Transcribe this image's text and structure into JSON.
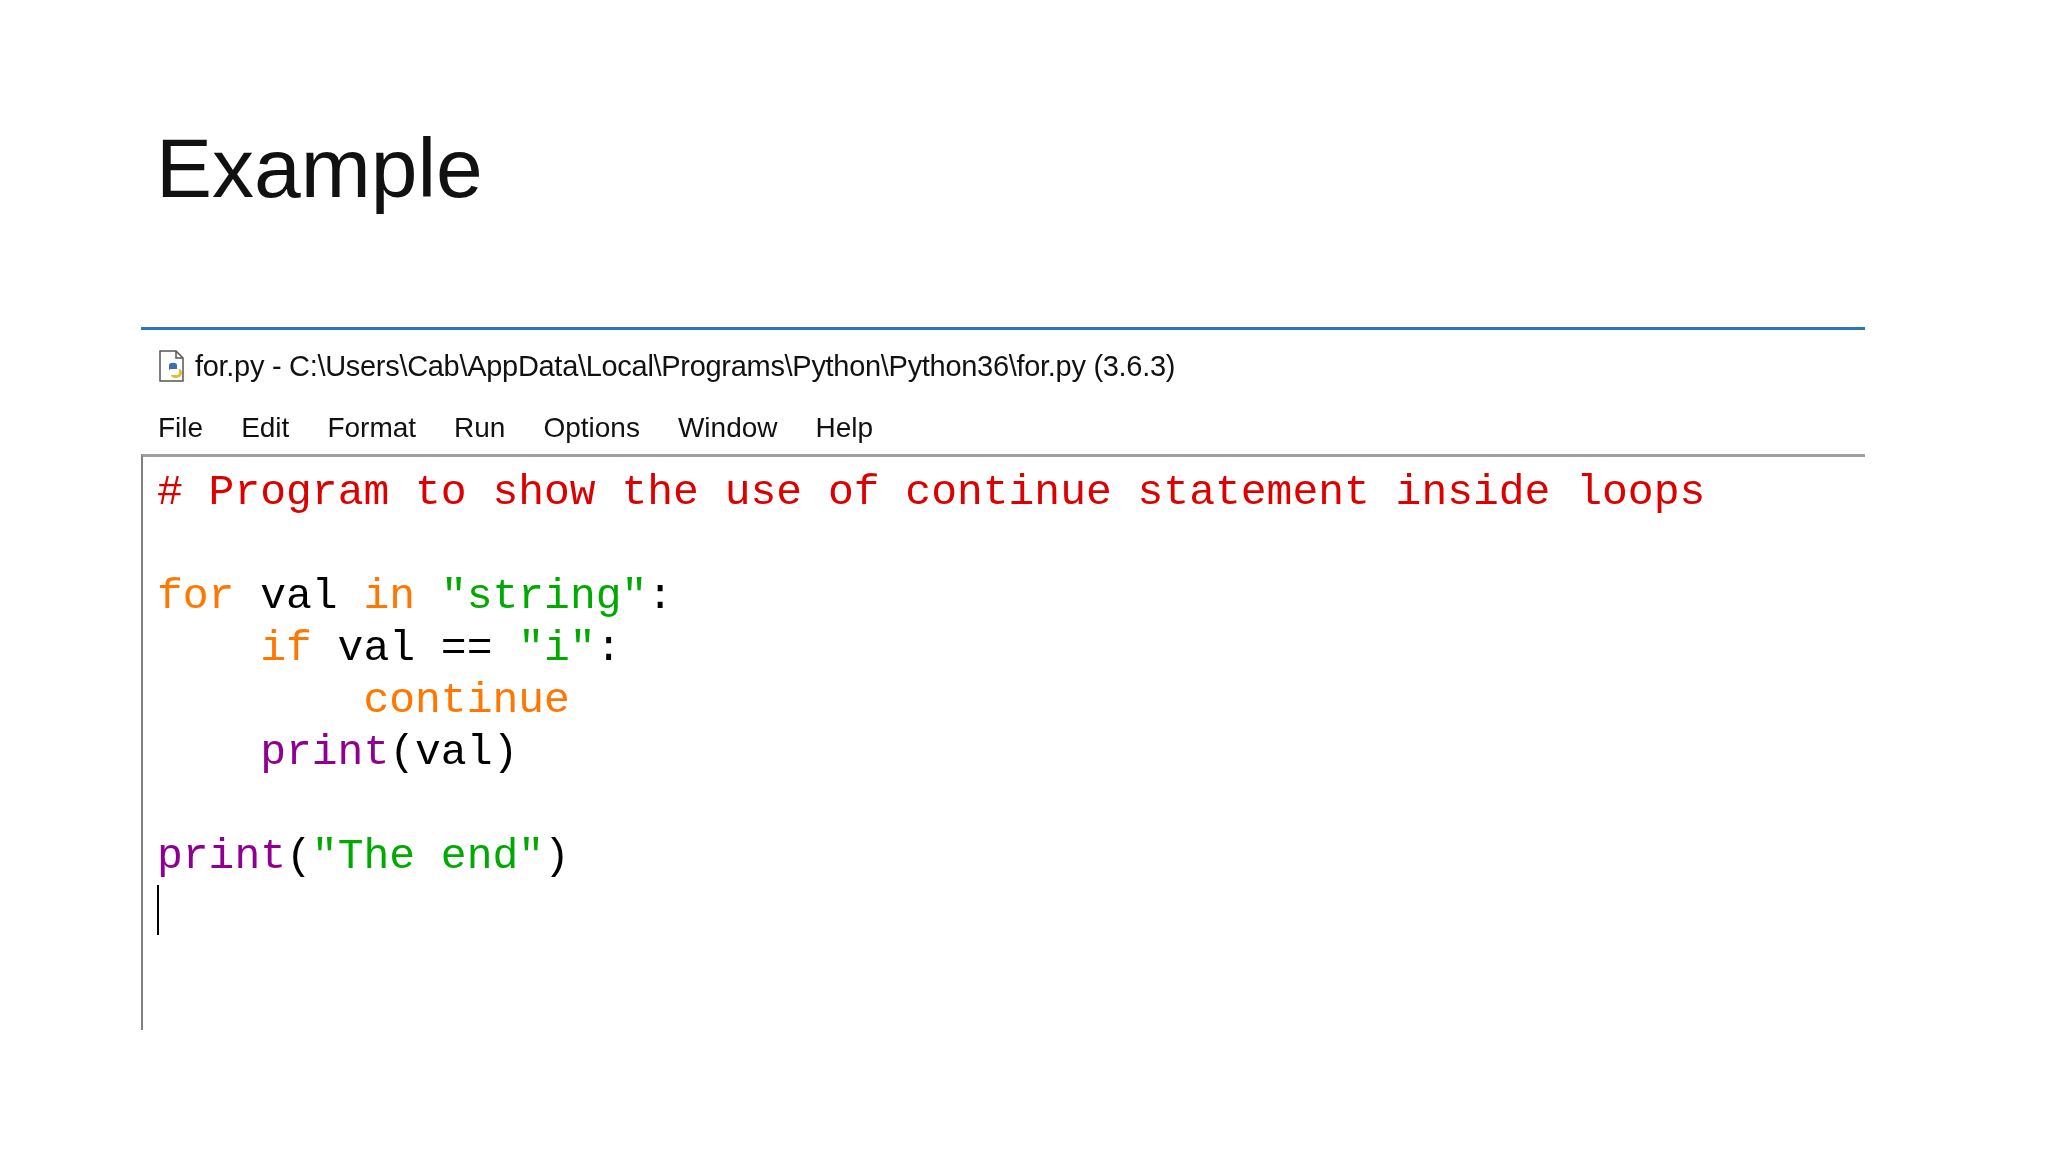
{
  "slide_title": "Example",
  "window": {
    "title": "for.py - C:\\Users\\Cab\\AppData\\Local\\Programs\\Python\\Python36\\for.py (3.6.3)",
    "menu": [
      "File",
      "Edit",
      "Format",
      "Run",
      "Options",
      "Window",
      "Help"
    ],
    "code": [
      {
        "kind": "code",
        "tokens": [
          {
            "kind": "comment",
            "text": "# Program to show the use of continue statement inside loops"
          }
        ]
      },
      {
        "kind": "blank"
      },
      {
        "kind": "code",
        "tokens": [
          {
            "kind": "keyword",
            "text": "for"
          },
          {
            "kind": "plain",
            "text": " val "
          },
          {
            "kind": "keyword",
            "text": "in "
          },
          {
            "kind": "string",
            "text": "\"string\""
          },
          {
            "kind": "plain",
            "text": ":"
          }
        ],
        "children": [
          {
            "kind": "code",
            "tokens": [
              {
                "kind": "keyword",
                "text": "if"
              },
              {
                "kind": "plain",
                "text": " val == "
              },
              {
                "kind": "string",
                "text": "\"i\""
              },
              {
                "kind": "plain",
                "text": ":"
              }
            ],
            "children": [
              {
                "kind": "code",
                "tokens": [
                  {
                    "kind": "keyword",
                    "text": "continue"
                  }
                ]
              }
            ]
          },
          {
            "kind": "code",
            "tokens": [
              {
                "kind": "builtin",
                "text": "print"
              },
              {
                "kind": "plain",
                "text": "(val)"
              }
            ]
          }
        ]
      },
      {
        "kind": "blank"
      },
      {
        "kind": "code",
        "tokens": [
          {
            "kind": "builtin",
            "text": "print"
          },
          {
            "kind": "plain",
            "text": "("
          },
          {
            "kind": "string",
            "text": "\"The end\""
          },
          {
            "kind": "plain",
            "text": ")"
          }
        ]
      }
    ]
  }
}
